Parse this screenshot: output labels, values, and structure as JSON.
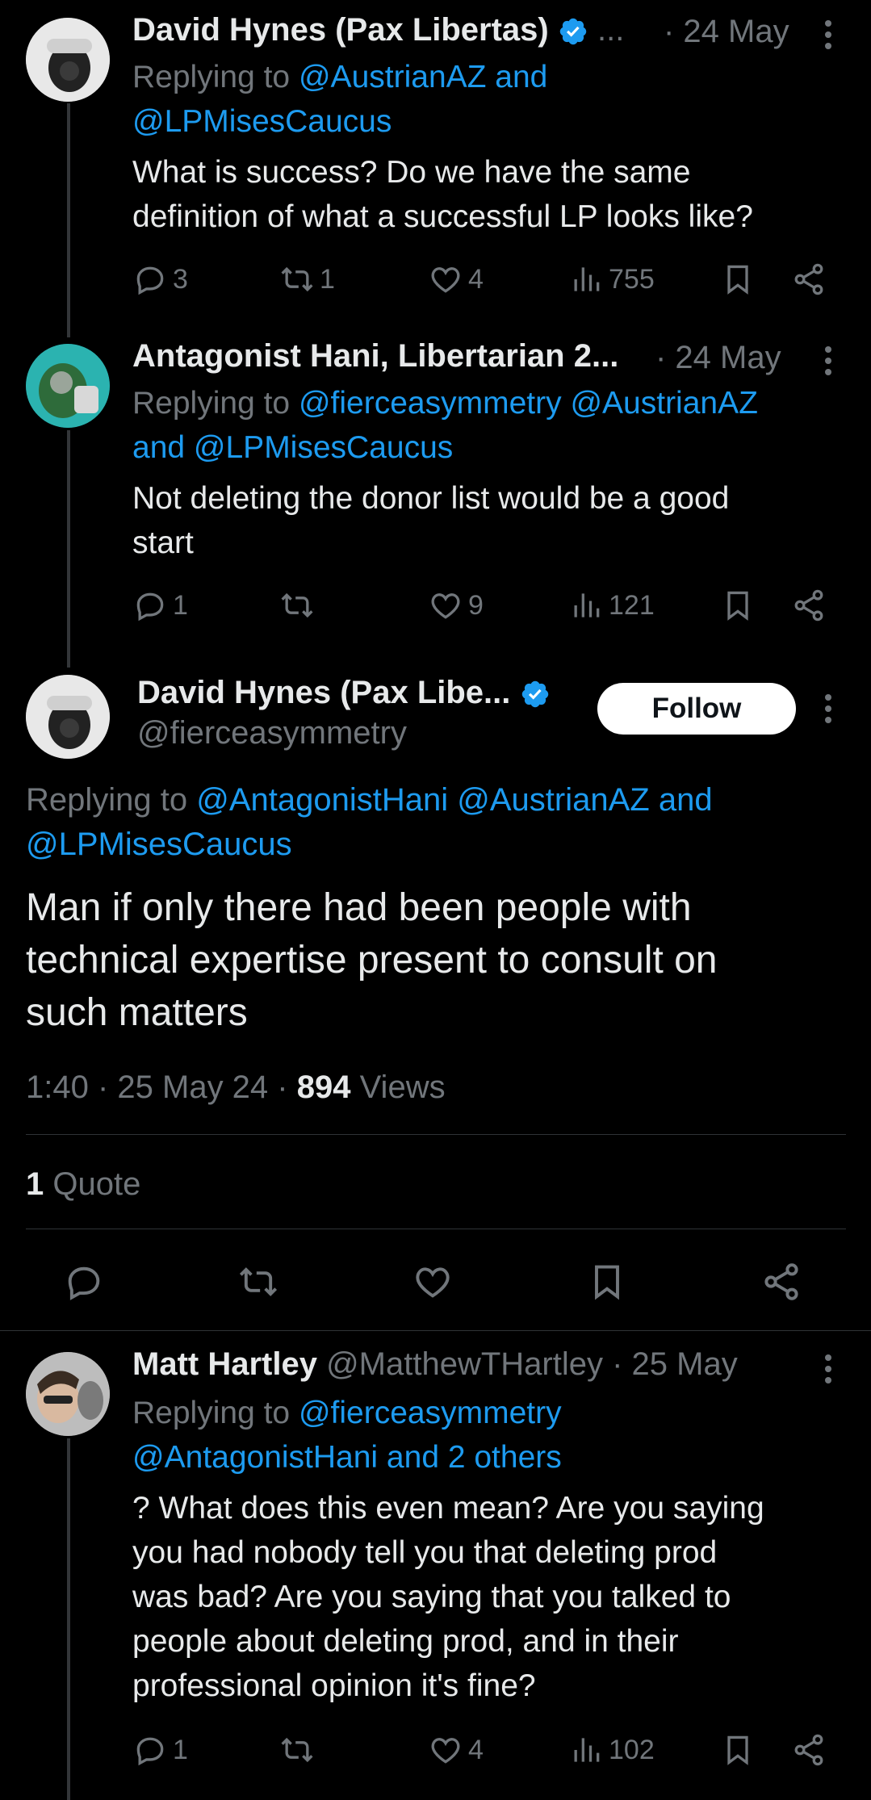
{
  "tweets": [
    {
      "name": "David Hynes (Pax Libertas)",
      "name_ellipsis": "...",
      "date": "· 24 May",
      "reply_prefix": "Replying to",
      "reply_handles_1": "@AustrianAZ and",
      "reply_handles_2": "@LPMisesCaucus",
      "text_1": "What is success? Do we have the same",
      "text_2": "definition of what a successful LP looks like?",
      "replies": "3",
      "reposts": "1",
      "likes": "4",
      "views": "755"
    },
    {
      "name": "Antagonist Hani, Libertarian 2...",
      "date": "· 24 May",
      "reply_prefix": "Replying to",
      "reply_handles_1": "@fierceasymmetry @AustrianAZ",
      "reply_handles_2": "and @LPMisesCaucus",
      "text_1": "Not deleting the donor list would be a good",
      "text_2": "start",
      "replies": "1",
      "reposts": "",
      "likes": "9",
      "views": "121"
    }
  ],
  "main": {
    "name": "David Hynes (Pax Libe...",
    "handle": "@fierceasymmetry",
    "follow_label": "Follow",
    "reply_prefix": "Replying to",
    "reply_handles_1": "@AntagonistHani @AustrianAZ and",
    "reply_handles_2": "@LPMisesCaucus",
    "text_1": "Man if only there had been people with",
    "text_2": "technical expertise present to consult on",
    "text_3": "such matters",
    "timestamp": "1:40 · 25 May 24 · ",
    "views_count": "894",
    "views_label": " Views",
    "quote_count": "1",
    "quote_label": " Quote"
  },
  "reply": {
    "name": "Matt Hartley",
    "handle": "@MatthewTHartley",
    "date": "· 25 May",
    "reply_prefix": "Replying to",
    "reply_handles_1": "@fierceasymmetry",
    "reply_handles_2": "@AntagonistHani and 2 others",
    "text_1": "? What does this even mean? Are you saying",
    "text_2": "you had nobody tell you that deleting prod",
    "text_3": "was bad? Are you saying that you talked to",
    "text_4": "people about deleting prod, and in their",
    "text_5": "professional opinion it's fine?",
    "replies": "1",
    "reposts": "",
    "likes": "4",
    "views": "102"
  },
  "colors": {
    "accent": "#1d9bf0",
    "muted": "#71767b",
    "text": "#e7e9ea",
    "bg": "#000000"
  },
  "icons": [
    "reply-icon",
    "repost-icon",
    "like-icon",
    "views-icon",
    "bookmark-icon",
    "share-icon",
    "verified-icon",
    "more-icon"
  ]
}
